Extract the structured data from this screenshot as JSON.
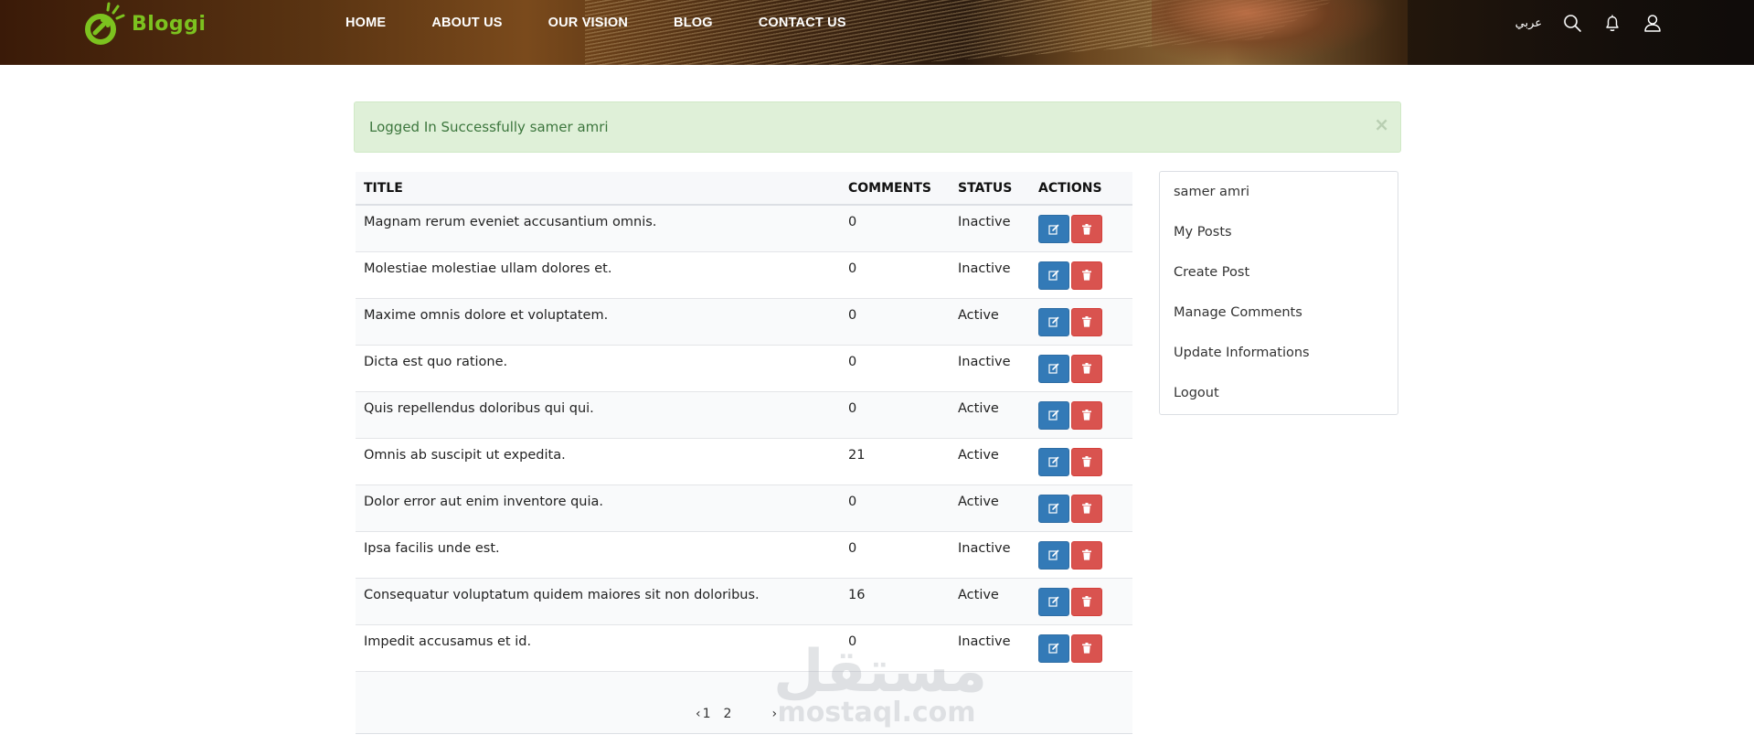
{
  "brand": {
    "name": "Bloggi",
    "color": "#7cc21f"
  },
  "nav": {
    "items": [
      "HOME",
      "ABOUT US",
      "OUR VISION",
      "BLOG",
      "CONTACT US"
    ]
  },
  "header_tools": {
    "language": "عربي",
    "icons": [
      "search-icon",
      "bell-icon",
      "user-icon"
    ]
  },
  "alert": {
    "message": "Logged In Successfully samer amri",
    "close": "×"
  },
  "table": {
    "headers": {
      "title": "TITLE",
      "comments": "COMMENTS",
      "status": "STATUS",
      "actions": "ACTIONS"
    },
    "rows": [
      {
        "title": "Magnam rerum eveniet accusantium omnis.",
        "comments": "0",
        "status": "Inactive"
      },
      {
        "title": "Molestiae molestiae ullam dolores et.",
        "comments": "0",
        "status": "Inactive"
      },
      {
        "title": "Maxime omnis dolore et voluptatem.",
        "comments": "0",
        "status": "Active"
      },
      {
        "title": "Dicta est quo ratione.",
        "comments": "0",
        "status": "Inactive"
      },
      {
        "title": "Quis repellendus doloribus qui qui.",
        "comments": "0",
        "status": "Active"
      },
      {
        "title": "Omnis ab suscipit ut expedita.",
        "comments": "21",
        "status": "Active"
      },
      {
        "title": "Dolor error aut enim inventore quia.",
        "comments": "0",
        "status": "Active"
      },
      {
        "title": "Ipsa facilis unde est.",
        "comments": "0",
        "status": "Inactive"
      },
      {
        "title": "Consequatur voluptatum quidem maiores sit non doloribus.",
        "comments": "16",
        "status": "Active"
      },
      {
        "title": "Impedit accusamus et id.",
        "comments": "0",
        "status": "Inactive"
      }
    ],
    "action_colors": {
      "edit": "#337ab7",
      "delete": "#d9534f"
    }
  },
  "pagination": {
    "prev": "‹",
    "pages": [
      "1",
      "2"
    ],
    "next": "›"
  },
  "sidebar": {
    "items": [
      "samer amri",
      "My Posts",
      "Create Post",
      "Manage Comments",
      "Update Informations",
      "Logout"
    ]
  },
  "watermark": {
    "arabic": "مستقل",
    "latin": "mostaql.com"
  }
}
